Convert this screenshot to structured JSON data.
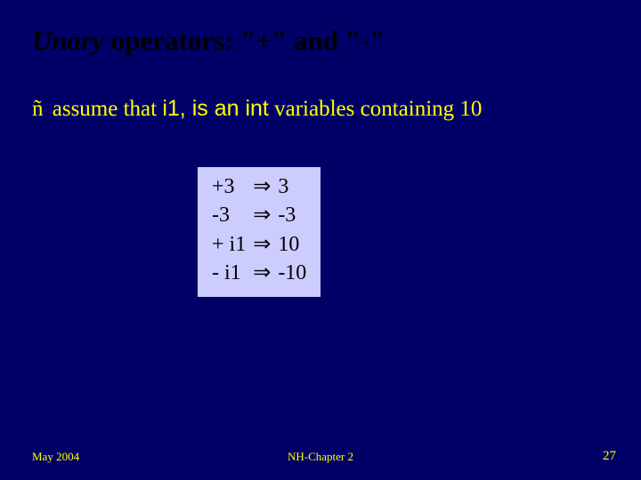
{
  "title": {
    "italic_part": "Unary",
    "rest": " operators: \"+\" and \"-\""
  },
  "bullet": {
    "icon": "ñ",
    "prefix": " assume that ",
    "code1": "i1, ",
    "mid": "is an ",
    "code2": "int",
    "suffix": " variables containing 10"
  },
  "examples": {
    "arrow": "⇒",
    "rows": [
      {
        "lhs": "+3",
        "rhs": "  3"
      },
      {
        "lhs": "-3",
        "rhs": " -3"
      },
      {
        "lhs": "+ i1",
        "rhs": " 10"
      },
      {
        "lhs": "- i1",
        "rhs": " -10"
      }
    ]
  },
  "footer": {
    "left": "May 2004",
    "center": "NH-Chapter 2",
    "right": "27"
  }
}
